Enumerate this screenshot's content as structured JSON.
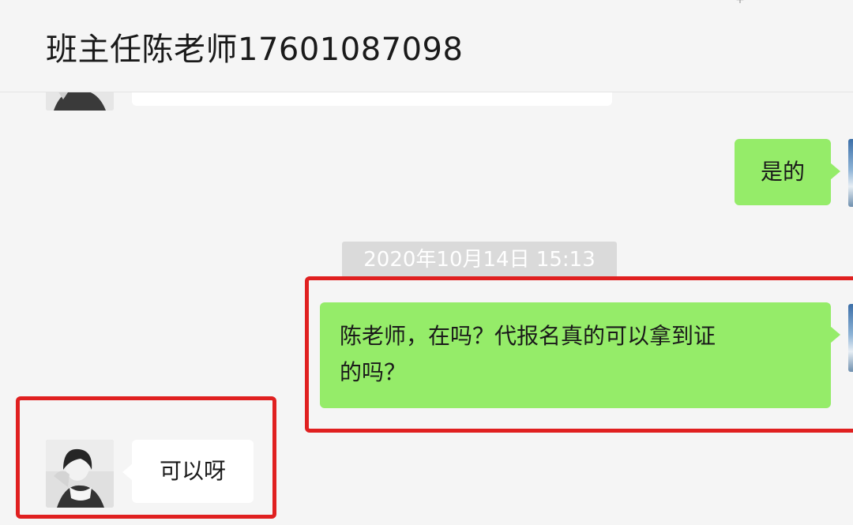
{
  "header": {
    "title": "班主任陈老师17601087098",
    "more_icon": "plus-icon"
  },
  "messages": [
    {
      "side": "left",
      "text": "",
      "type": "partial-bubble"
    },
    {
      "side": "right",
      "text": "是的"
    },
    {
      "side": "right",
      "text_line1": "陈老师，在吗？代报名真的可以拿到证",
      "text_line2": "的吗？"
    },
    {
      "side": "left",
      "text": "可以呀"
    }
  ],
  "timestamp": "2020年10月14日 15:13",
  "colors": {
    "background": "#f5f5f5",
    "own_bubble": "#95ec69",
    "other_bubble": "#ffffff",
    "highlight": "#e02020"
  }
}
